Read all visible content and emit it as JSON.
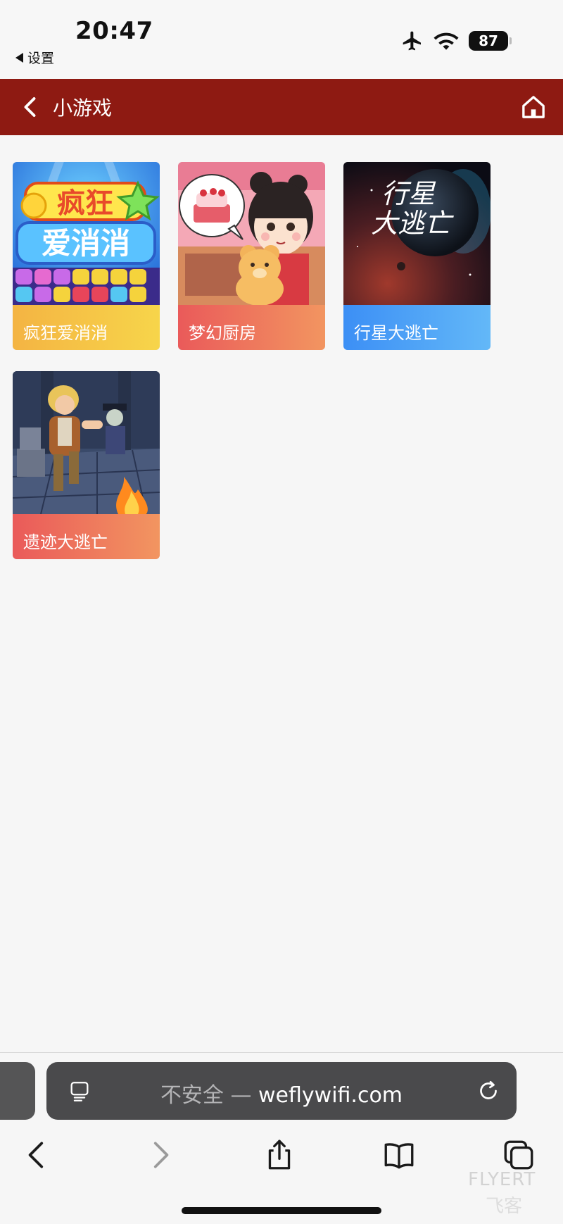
{
  "status": {
    "time": "20:47",
    "back_app_label": "设置",
    "battery_level": "87"
  },
  "appbar": {
    "title": "小游戏"
  },
  "games": [
    {
      "label": "疯狂爱消消"
    },
    {
      "label": "梦幻厨房"
    },
    {
      "label": "行星大逃亡"
    },
    {
      "label": "遗迹大逃亡"
    }
  ],
  "browser": {
    "insecure_label": "不安全",
    "separator": " — ",
    "domain": "weflywifi.com"
  },
  "watermark": {
    "line1": "FLYERT",
    "line2": "飞客"
  },
  "colors": {
    "appbar": "#8e1a12",
    "urlbar": "#4a4a4c"
  }
}
